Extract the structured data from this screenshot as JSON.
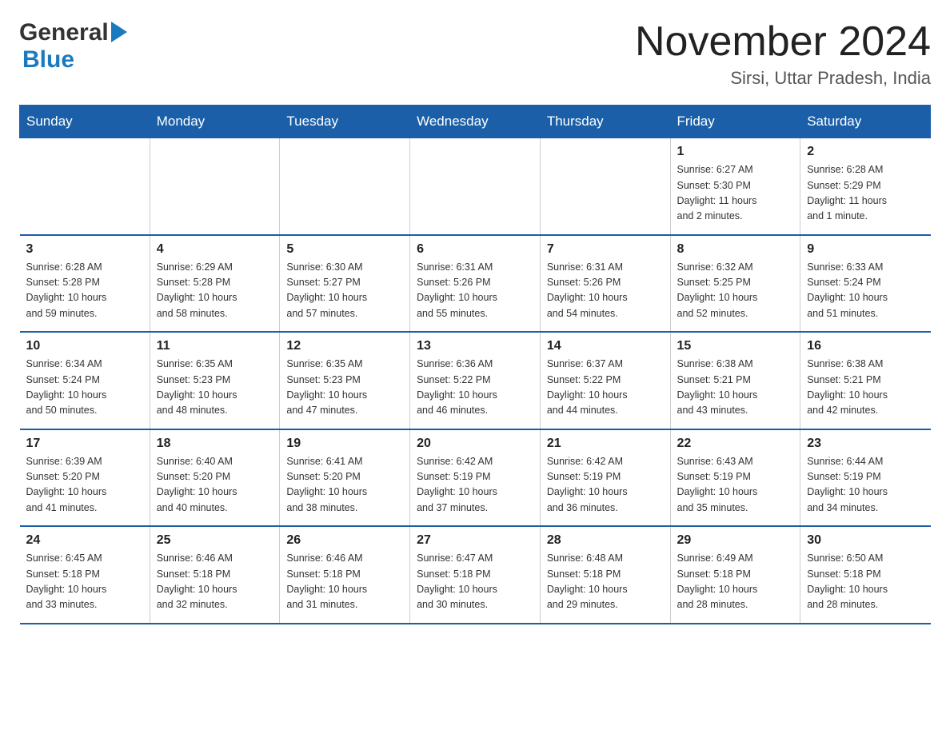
{
  "header": {
    "logo_general": "General",
    "logo_blue": "Blue",
    "month_title": "November 2024",
    "location": "Sirsi, Uttar Pradesh, India"
  },
  "weekdays": [
    "Sunday",
    "Monday",
    "Tuesday",
    "Wednesday",
    "Thursday",
    "Friday",
    "Saturday"
  ],
  "weeks": [
    [
      {
        "day": "",
        "info": ""
      },
      {
        "day": "",
        "info": ""
      },
      {
        "day": "",
        "info": ""
      },
      {
        "day": "",
        "info": ""
      },
      {
        "day": "",
        "info": ""
      },
      {
        "day": "1",
        "info": "Sunrise: 6:27 AM\nSunset: 5:30 PM\nDaylight: 11 hours\nand 2 minutes."
      },
      {
        "day": "2",
        "info": "Sunrise: 6:28 AM\nSunset: 5:29 PM\nDaylight: 11 hours\nand 1 minute."
      }
    ],
    [
      {
        "day": "3",
        "info": "Sunrise: 6:28 AM\nSunset: 5:28 PM\nDaylight: 10 hours\nand 59 minutes."
      },
      {
        "day": "4",
        "info": "Sunrise: 6:29 AM\nSunset: 5:28 PM\nDaylight: 10 hours\nand 58 minutes."
      },
      {
        "day": "5",
        "info": "Sunrise: 6:30 AM\nSunset: 5:27 PM\nDaylight: 10 hours\nand 57 minutes."
      },
      {
        "day": "6",
        "info": "Sunrise: 6:31 AM\nSunset: 5:26 PM\nDaylight: 10 hours\nand 55 minutes."
      },
      {
        "day": "7",
        "info": "Sunrise: 6:31 AM\nSunset: 5:26 PM\nDaylight: 10 hours\nand 54 minutes."
      },
      {
        "day": "8",
        "info": "Sunrise: 6:32 AM\nSunset: 5:25 PM\nDaylight: 10 hours\nand 52 minutes."
      },
      {
        "day": "9",
        "info": "Sunrise: 6:33 AM\nSunset: 5:24 PM\nDaylight: 10 hours\nand 51 minutes."
      }
    ],
    [
      {
        "day": "10",
        "info": "Sunrise: 6:34 AM\nSunset: 5:24 PM\nDaylight: 10 hours\nand 50 minutes."
      },
      {
        "day": "11",
        "info": "Sunrise: 6:35 AM\nSunset: 5:23 PM\nDaylight: 10 hours\nand 48 minutes."
      },
      {
        "day": "12",
        "info": "Sunrise: 6:35 AM\nSunset: 5:23 PM\nDaylight: 10 hours\nand 47 minutes."
      },
      {
        "day": "13",
        "info": "Sunrise: 6:36 AM\nSunset: 5:22 PM\nDaylight: 10 hours\nand 46 minutes."
      },
      {
        "day": "14",
        "info": "Sunrise: 6:37 AM\nSunset: 5:22 PM\nDaylight: 10 hours\nand 44 minutes."
      },
      {
        "day": "15",
        "info": "Sunrise: 6:38 AM\nSunset: 5:21 PM\nDaylight: 10 hours\nand 43 minutes."
      },
      {
        "day": "16",
        "info": "Sunrise: 6:38 AM\nSunset: 5:21 PM\nDaylight: 10 hours\nand 42 minutes."
      }
    ],
    [
      {
        "day": "17",
        "info": "Sunrise: 6:39 AM\nSunset: 5:20 PM\nDaylight: 10 hours\nand 41 minutes."
      },
      {
        "day": "18",
        "info": "Sunrise: 6:40 AM\nSunset: 5:20 PM\nDaylight: 10 hours\nand 40 minutes."
      },
      {
        "day": "19",
        "info": "Sunrise: 6:41 AM\nSunset: 5:20 PM\nDaylight: 10 hours\nand 38 minutes."
      },
      {
        "day": "20",
        "info": "Sunrise: 6:42 AM\nSunset: 5:19 PM\nDaylight: 10 hours\nand 37 minutes."
      },
      {
        "day": "21",
        "info": "Sunrise: 6:42 AM\nSunset: 5:19 PM\nDaylight: 10 hours\nand 36 minutes."
      },
      {
        "day": "22",
        "info": "Sunrise: 6:43 AM\nSunset: 5:19 PM\nDaylight: 10 hours\nand 35 minutes."
      },
      {
        "day": "23",
        "info": "Sunrise: 6:44 AM\nSunset: 5:19 PM\nDaylight: 10 hours\nand 34 minutes."
      }
    ],
    [
      {
        "day": "24",
        "info": "Sunrise: 6:45 AM\nSunset: 5:18 PM\nDaylight: 10 hours\nand 33 minutes."
      },
      {
        "day": "25",
        "info": "Sunrise: 6:46 AM\nSunset: 5:18 PM\nDaylight: 10 hours\nand 32 minutes."
      },
      {
        "day": "26",
        "info": "Sunrise: 6:46 AM\nSunset: 5:18 PM\nDaylight: 10 hours\nand 31 minutes."
      },
      {
        "day": "27",
        "info": "Sunrise: 6:47 AM\nSunset: 5:18 PM\nDaylight: 10 hours\nand 30 minutes."
      },
      {
        "day": "28",
        "info": "Sunrise: 6:48 AM\nSunset: 5:18 PM\nDaylight: 10 hours\nand 29 minutes."
      },
      {
        "day": "29",
        "info": "Sunrise: 6:49 AM\nSunset: 5:18 PM\nDaylight: 10 hours\nand 28 minutes."
      },
      {
        "day": "30",
        "info": "Sunrise: 6:50 AM\nSunset: 5:18 PM\nDaylight: 10 hours\nand 28 minutes."
      }
    ]
  ]
}
